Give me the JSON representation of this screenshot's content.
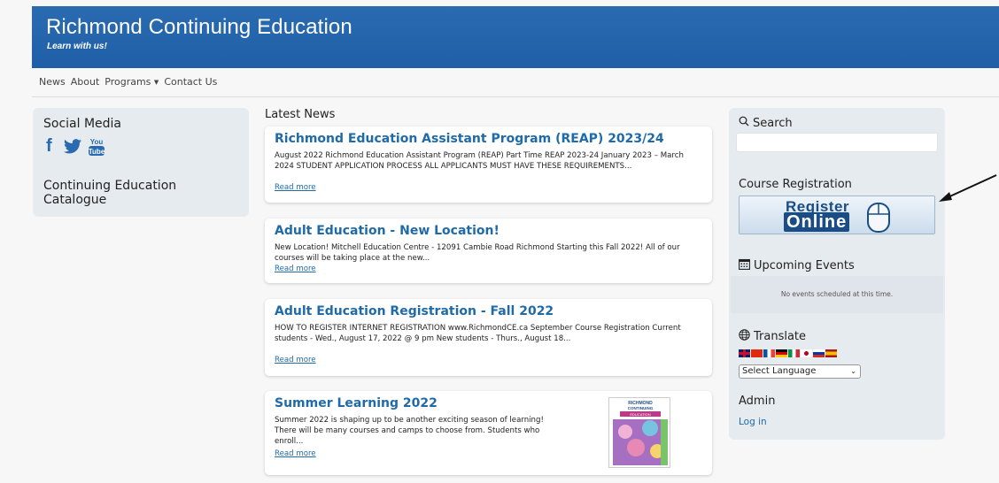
{
  "header": {
    "title": "Richmond Continuing Education",
    "tagline": "Learn with us!"
  },
  "nav": {
    "items": [
      "News",
      "About",
      "Programs",
      "Contact Us"
    ]
  },
  "left_sidebar": {
    "social_title": "Social Media",
    "social_icons": [
      "facebook-icon",
      "twitter-icon",
      "youtube-icon"
    ],
    "youtube_text_top": "You",
    "youtube_text_bottom": "Tube",
    "catalogue_title": "Continuing Education Catalogue"
  },
  "main": {
    "latest_title": "Latest News",
    "articles": [
      {
        "title": "Richmond Education Assistant Program (REAP) 2023/24",
        "excerpt": "August 2022 Richmond Education Assistant Program (REAP) Part Time REAP 2023-24 January 2023 – March 2024 STUDENT APPLICATION PROCESS ALL APPLICANTS MUST HAVE THESE REQUIREMENTS...",
        "link": "Read more"
      },
      {
        "title": "Adult Education - New Location!",
        "excerpt": "New Location! Mitchell Education Centre - 12091 Cambie Road Richmond Starting this Fall 2022! All of our courses will be taking place at the new...",
        "link": "Read more"
      },
      {
        "title": "Adult Education Registration - Fall 2022",
        "excerpt": "HOW TO REGISTER INTERNET REGISTRATION www.RichmondCE.ca September Course Registration Current students - Wed., August 17, 2022 @ 9 pm New students - Thurs., August 18...",
        "link": "Read more"
      },
      {
        "title": "Summer Learning 2022",
        "excerpt": "Summer 2022 is shaping up to be another exciting season of learning! There will be many courses and camps to choose from. Students who enroll...",
        "link": "Read more",
        "thumb_line1": "RICHMOND",
        "thumb_line2": "CONTINUING",
        "thumb_line3": "EDUCATION"
      }
    ]
  },
  "right_sidebar": {
    "search_title": "Search",
    "course_reg_title": "Course Registration",
    "register_line1": "Register",
    "register_line2": "Online",
    "events_title": "Upcoming Events",
    "events_empty": "No events scheduled at this time.",
    "translate_title": "Translate",
    "flags": [
      "flag-uk",
      "flag-china",
      "flag-france",
      "flag-germany",
      "flag-italy",
      "flag-japan",
      "flag-russia",
      "flag-spain"
    ],
    "language_select": "Select Language",
    "admin_title": "Admin",
    "login_label": "Log in"
  },
  "colors": {
    "header_bg": "#2a6bb0",
    "link": "#1f6aa8",
    "sidebar_bg": "#e6ebef"
  }
}
